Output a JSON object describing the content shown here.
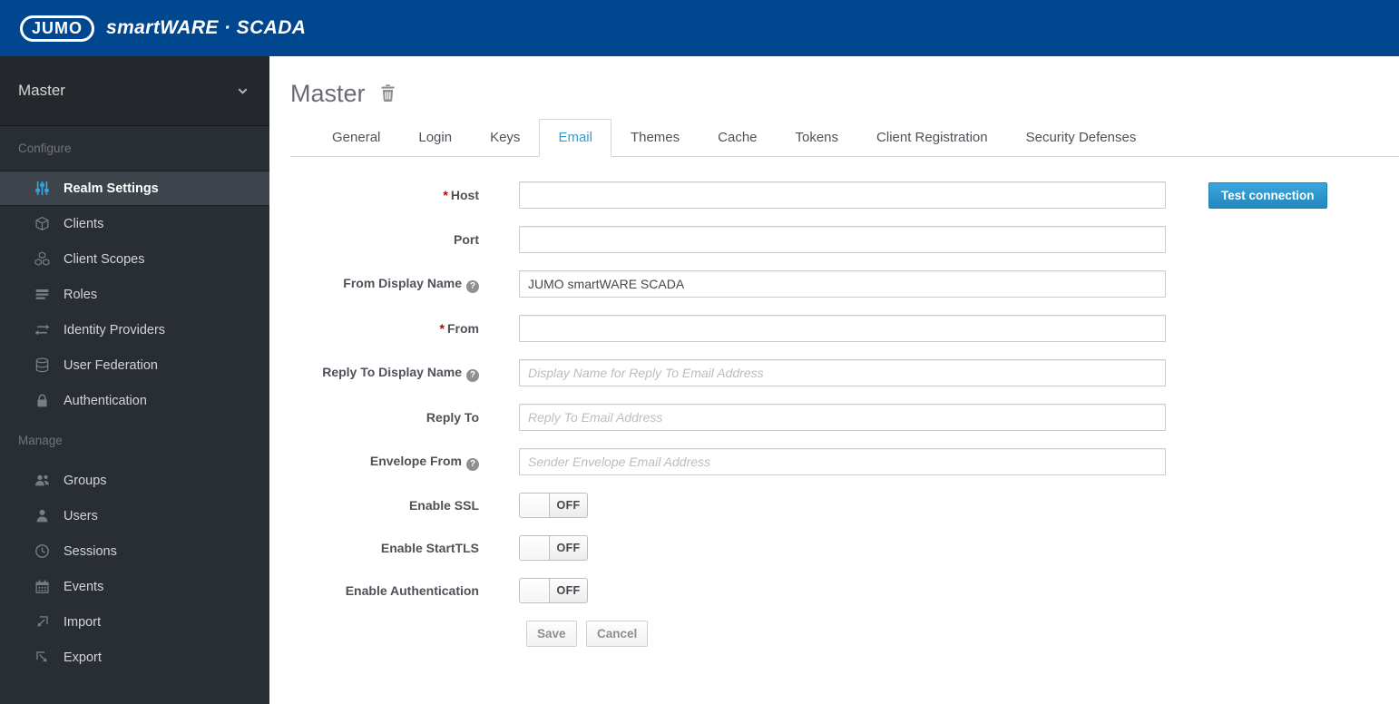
{
  "header": {
    "logo": "JUMO",
    "brand": "smartWARE · SCADA"
  },
  "sidebar": {
    "realm_selector": {
      "label": "Master"
    },
    "sections": [
      {
        "label": "Configure",
        "items": [
          {
            "label": "Realm Settings",
            "icon": "sliders-icon",
            "active": true
          },
          {
            "label": "Clients",
            "icon": "cube-icon",
            "active": false
          },
          {
            "label": "Client Scopes",
            "icon": "cubes-icon",
            "active": false
          },
          {
            "label": "Roles",
            "icon": "list-icon",
            "active": false
          },
          {
            "label": "Identity Providers",
            "icon": "exchange-icon",
            "active": false
          },
          {
            "label": "User Federation",
            "icon": "database-icon",
            "active": false
          },
          {
            "label": "Authentication",
            "icon": "lock-icon",
            "active": false
          }
        ]
      },
      {
        "label": "Manage",
        "items": [
          {
            "label": "Groups",
            "icon": "users-icon",
            "active": false
          },
          {
            "label": "Users",
            "icon": "user-icon",
            "active": false
          },
          {
            "label": "Sessions",
            "icon": "clock-icon",
            "active": false
          },
          {
            "label": "Events",
            "icon": "calendar-icon",
            "active": false
          },
          {
            "label": "Import",
            "icon": "import-icon",
            "active": false
          },
          {
            "label": "Export",
            "icon": "export-icon",
            "active": false
          }
        ]
      }
    ]
  },
  "main": {
    "title": "Master",
    "tabs": [
      "General",
      "Login",
      "Keys",
      "Email",
      "Themes",
      "Cache",
      "Tokens",
      "Client Registration",
      "Security Defenses"
    ],
    "active_tab": "Email",
    "form": {
      "required_marker": "*",
      "help_glyph": "?",
      "test_connection_label": "Test connection",
      "fields": [
        {
          "label": "Host",
          "required": true,
          "value": "",
          "placeholder": ""
        },
        {
          "label": "Port",
          "required": false,
          "value": "",
          "placeholder": ""
        },
        {
          "label": "From Display Name",
          "required": false,
          "help": true,
          "value": "JUMO smartWARE SCADA",
          "placeholder": ""
        },
        {
          "label": "From",
          "required": true,
          "value": "",
          "placeholder": ""
        },
        {
          "label": "Reply To Display Name",
          "required": false,
          "help": true,
          "value": "",
          "placeholder": "Display Name for Reply To Email Address"
        },
        {
          "label": "Reply To",
          "required": false,
          "value": "",
          "placeholder": "Reply To Email Address"
        },
        {
          "label": "Envelope From",
          "required": false,
          "help": true,
          "value": "",
          "placeholder": "Sender Envelope Email Address"
        }
      ],
      "toggles": [
        {
          "label": "Enable SSL",
          "state": "OFF"
        },
        {
          "label": "Enable StartTLS",
          "state": "OFF"
        },
        {
          "label": "Enable Authentication",
          "state": "OFF"
        }
      ],
      "actions": {
        "save_label": "Save",
        "cancel_label": "Cancel"
      }
    }
  },
  "colors": {
    "header_bg": "#00478f",
    "sidebar_bg": "#292e34",
    "active_item_bg": "#3d444b",
    "accent_blue": "#39a5dc",
    "active_tab_text": "#2d9fd8",
    "primary_button": "#2f96cc",
    "required_red": "#c00000"
  }
}
